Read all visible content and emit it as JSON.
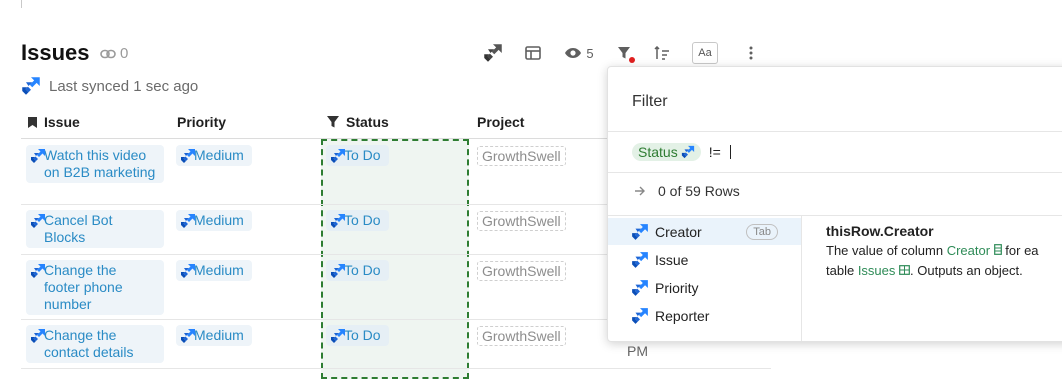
{
  "page": {
    "title": "Issues",
    "link_count": "0",
    "synced_text": "Last synced 1 sec ago"
  },
  "toolbar": {
    "view_count": "5",
    "text_style_label": "Aa"
  },
  "table": {
    "columns": [
      "Issue",
      "Priority",
      "Status",
      "Project"
    ],
    "rows": [
      {
        "issue": "Watch this video on B2B marketing",
        "priority": "Medium",
        "status": "To Do",
        "project": "GrowthSwell"
      },
      {
        "issue": "Cancel Bot Blocks",
        "priority": "Medium",
        "status": "To Do",
        "project": "GrowthSwell"
      },
      {
        "issue": "Change the footer phone number",
        "priority": "Medium",
        "status": "To Do",
        "project": "GrowthSwell"
      },
      {
        "issue": "Change the contact details",
        "priority": "Medium",
        "status": "To Do",
        "project": "GrowthSwell"
      }
    ],
    "partial_date_cell": "PM"
  },
  "filter_panel": {
    "title": "Filter",
    "formula_chip": "Status",
    "formula_operator": "!=",
    "rows_info": "0 of 59 Rows",
    "suggestions": [
      "Creator",
      "Issue",
      "Priority",
      "Reporter"
    ],
    "tab_key": "Tab",
    "help": {
      "title": "thisRow.Creator",
      "line1_prefix": "The value of column ",
      "line1_column": "Creator",
      "line1_suffix": " for ea",
      "line2_prefix": "table ",
      "line2_table": "Issues",
      "line2_suffix": ". Outputs an object."
    }
  },
  "colors": {
    "accent": "#2a8bc5",
    "status_highlight": "#2e7d32",
    "filter_dot": "#e02020"
  }
}
